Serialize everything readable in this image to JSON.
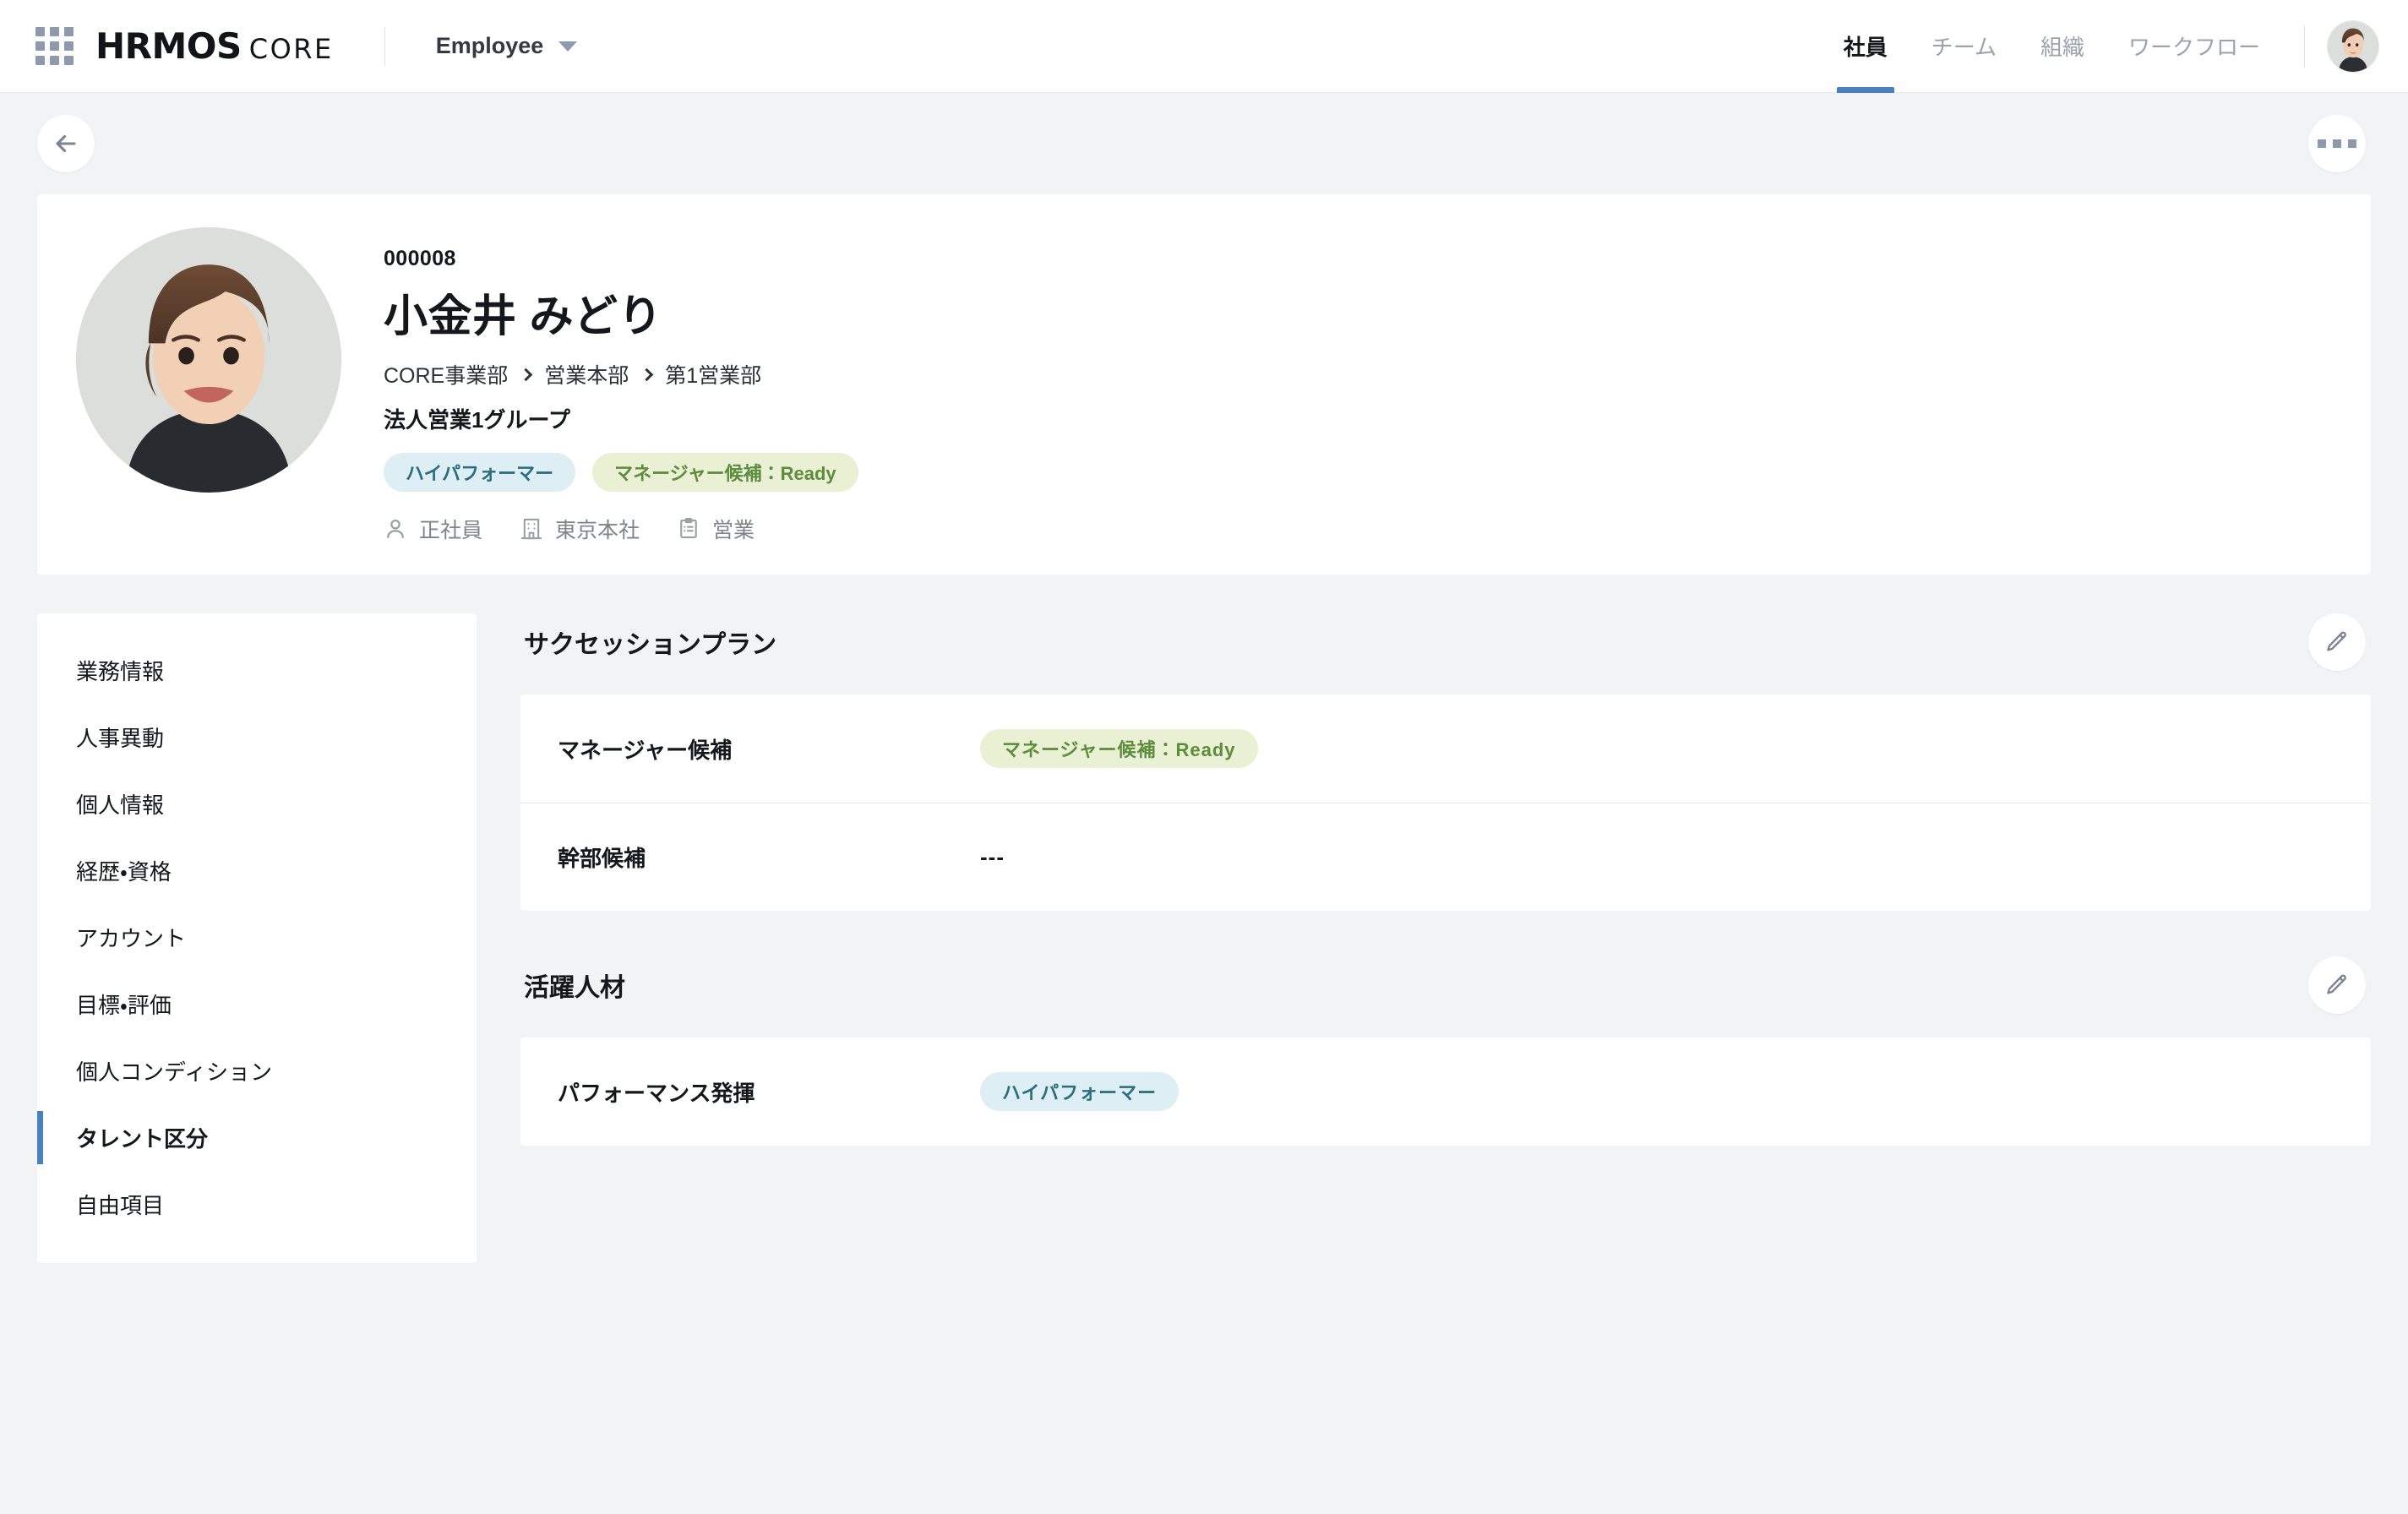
{
  "topbar": {
    "apps_icon": "apps-grid-icon",
    "logo_primary": "HRMOS",
    "logo_secondary": "CORE",
    "product_switch_label": "Employee",
    "nav": [
      {
        "label": "社員",
        "active": true
      },
      {
        "label": "チーム",
        "active": false
      },
      {
        "label": "組織",
        "active": false
      },
      {
        "label": "ワークフロー",
        "active": false
      }
    ],
    "user_avatar_alt": "user-avatar"
  },
  "toolbar": {
    "back_icon": "arrow-left-icon",
    "more_icon": "more-horizontal-icon"
  },
  "profile": {
    "employee_code": "000008",
    "name": "小金井 みどり",
    "breadcrumb": [
      "CORE事業部",
      "営業本部",
      "第1営業部"
    ],
    "group": "法人営業1グループ",
    "tags": [
      {
        "label": "ハイパフォーマー",
        "style": "blue"
      },
      {
        "label": "マネージャー候補：Ready",
        "style": "green"
      }
    ],
    "meta": [
      {
        "icon": "person-icon",
        "label": "正社員"
      },
      {
        "icon": "building-icon",
        "label": "東京本社"
      },
      {
        "icon": "clipboard-icon",
        "label": "営業"
      }
    ]
  },
  "sidebar": {
    "items": [
      {
        "label": "業務情報",
        "active": false
      },
      {
        "label": "人事異動",
        "active": false
      },
      {
        "label": "個人情報",
        "active": false
      },
      {
        "label": "経歴・資格",
        "active": false
      },
      {
        "label": "アカウント",
        "active": false
      },
      {
        "label": "目標・評価",
        "active": false
      },
      {
        "label": "個人コンディション",
        "active": false
      },
      {
        "label": "タレント区分",
        "active": true
      },
      {
        "label": "自由項目",
        "active": false
      }
    ]
  },
  "main": {
    "sections": [
      {
        "title": "サクセッションプラン",
        "edit_icon": "pencil-edit-icon",
        "rows": [
          {
            "label": "マネージャー候補",
            "value": "マネージャー候補：Ready",
            "value_type": "tag",
            "tag_style": "green"
          },
          {
            "label": "幹部候補",
            "value": "---",
            "value_type": "text"
          }
        ]
      },
      {
        "title": "活躍人材",
        "edit_icon": "pencil-edit-icon",
        "rows": [
          {
            "label": "パフォーマンス発揮",
            "value": "ハイパフォーマー",
            "value_type": "tag",
            "tag_style": "blue"
          }
        ]
      }
    ]
  },
  "colors": {
    "page_bg": "#f2f3f5",
    "card_bg": "#ffffff",
    "accent_blue": "#4a7fc1",
    "tag_blue_bg": "#ddeef4",
    "tag_blue_text": "#2b6d7d",
    "tag_green_bg": "#e9f0d3",
    "tag_green_text": "#5d8c3c",
    "muted_text": "#7d848c",
    "icon_gray": "#8d9aab"
  }
}
